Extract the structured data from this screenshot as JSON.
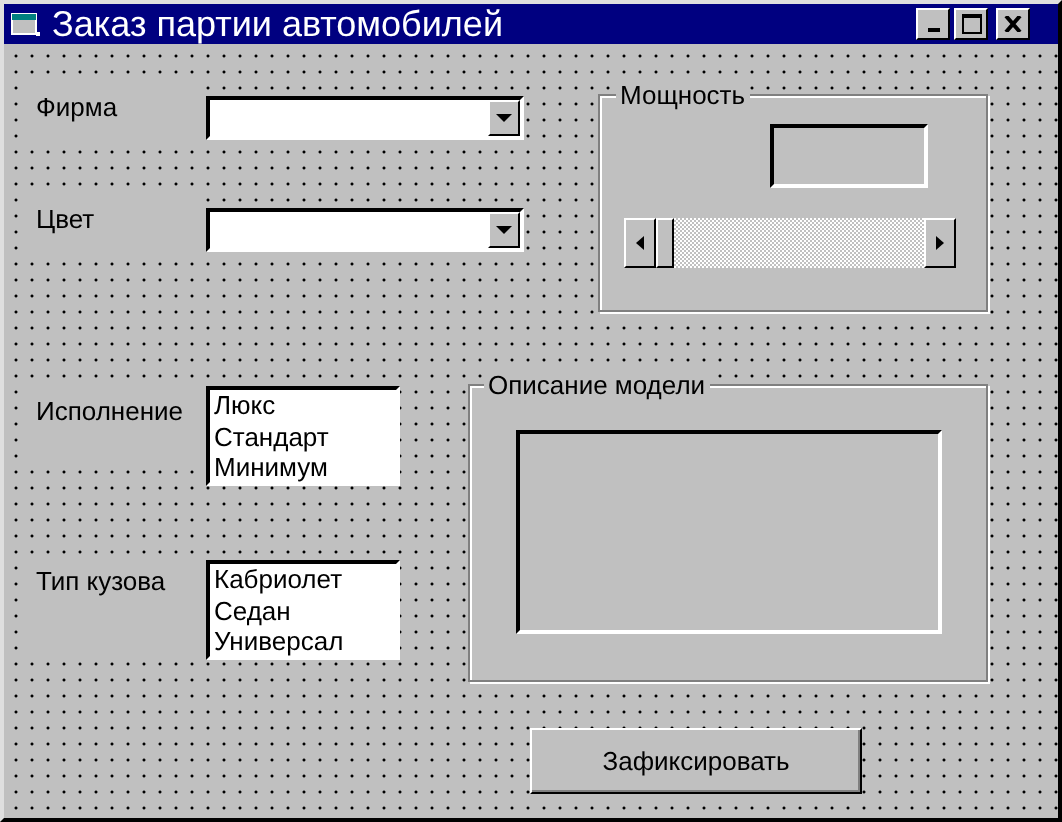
{
  "window": {
    "title": "Заказ партии автомобилей"
  },
  "fields": [
    {
      "label": "Фирма",
      "kind": "combo"
    },
    {
      "label": "Цвет",
      "kind": "combo"
    },
    {
      "label": "Исполнение",
      "kind": "list",
      "items": [
        {
          "text": "Люкс",
          "selected": false
        },
        {
          "text": "Стандарт",
          "selected": false
        },
        {
          "text": "Минимум",
          "selected": false
        }
      ]
    },
    {
      "label": "Тип кузова",
      "kind": "list",
      "items": [
        {
          "text": "Кабриолет",
          "selected": false
        },
        {
          "text": "Седан",
          "selected": false
        },
        {
          "text": "Универсал",
          "selected": false
        }
      ]
    }
  ],
  "power_frame": {
    "title": "Мощность"
  },
  "description_frame": {
    "title": "Описание модели"
  },
  "buttons": [
    "Зафиксировать"
  ]
}
